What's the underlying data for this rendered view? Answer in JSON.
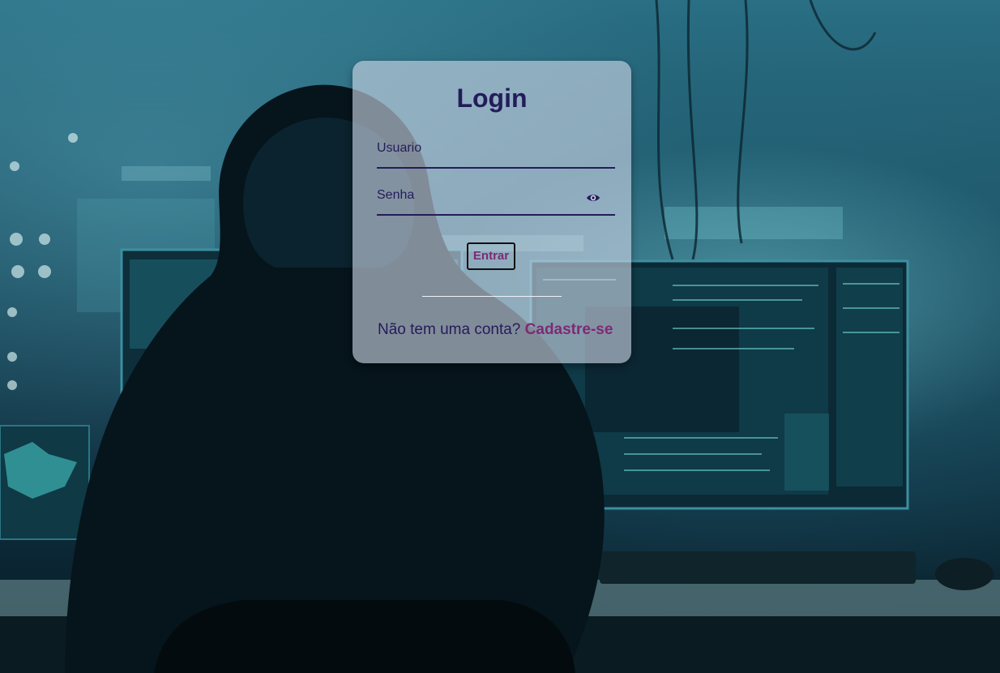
{
  "login": {
    "title": "Login",
    "username_label": "Usuario",
    "password_label": "Senha",
    "submit_label": "Entrar",
    "no_account_text": "Não tem uma conta?",
    "signup_link": "Cadastre-se"
  },
  "icons": {
    "password_toggle": "eye-icon"
  },
  "colors": {
    "text_primary": "#241c5a",
    "accent": "#7e2a74",
    "card_bg": "rgba(205,215,230,0.62)"
  }
}
